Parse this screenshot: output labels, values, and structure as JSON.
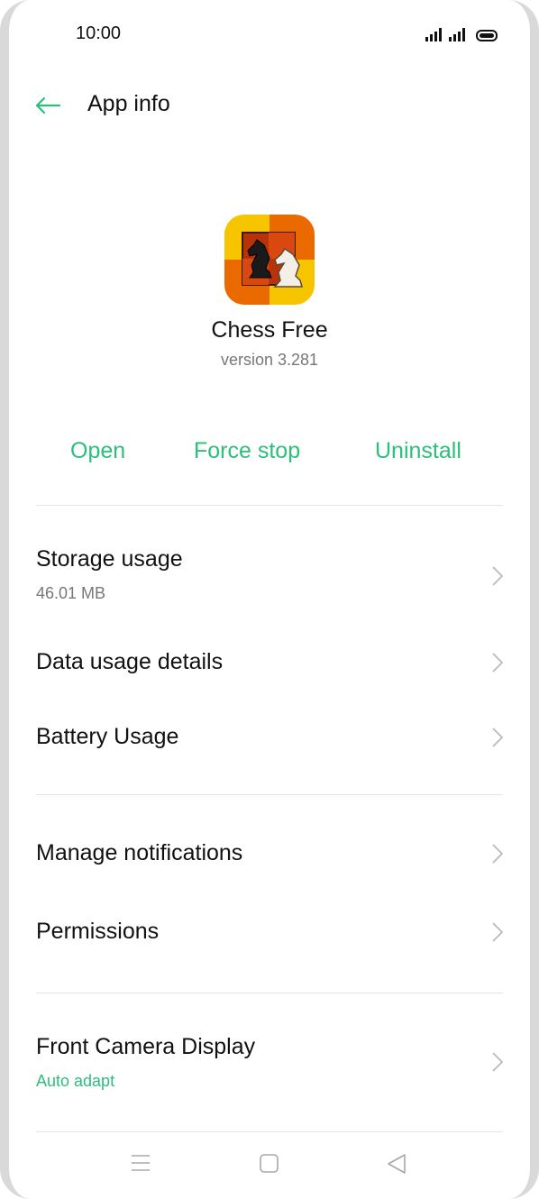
{
  "status_bar": {
    "time": "10:00"
  },
  "header": {
    "title": "App info",
    "back_icon": "arrow-left-icon"
  },
  "app": {
    "name": "Chess Free",
    "version": "version 3.281"
  },
  "actions": {
    "open": "Open",
    "force_stop": "Force stop",
    "uninstall": "Uninstall"
  },
  "rows": {
    "storage": {
      "title": "Storage usage",
      "subtitle": "46.01 MB"
    },
    "data_usage": {
      "title": "Data usage details"
    },
    "battery": {
      "title": "Battery Usage"
    },
    "notifications": {
      "title": "Manage notifications"
    },
    "permissions": {
      "title": "Permissions"
    },
    "front_camera": {
      "title": "Front Camera Display",
      "subtitle": "Auto adapt"
    }
  },
  "colors": {
    "accent": "#2bbf7a",
    "text_primary": "#111111",
    "text_secondary": "#777777",
    "divider": "#e4e4e4"
  },
  "nav_bar": {
    "recents_icon": "menu-lines-icon",
    "home_icon": "square-home-icon",
    "back_icon": "triangle-back-icon"
  }
}
